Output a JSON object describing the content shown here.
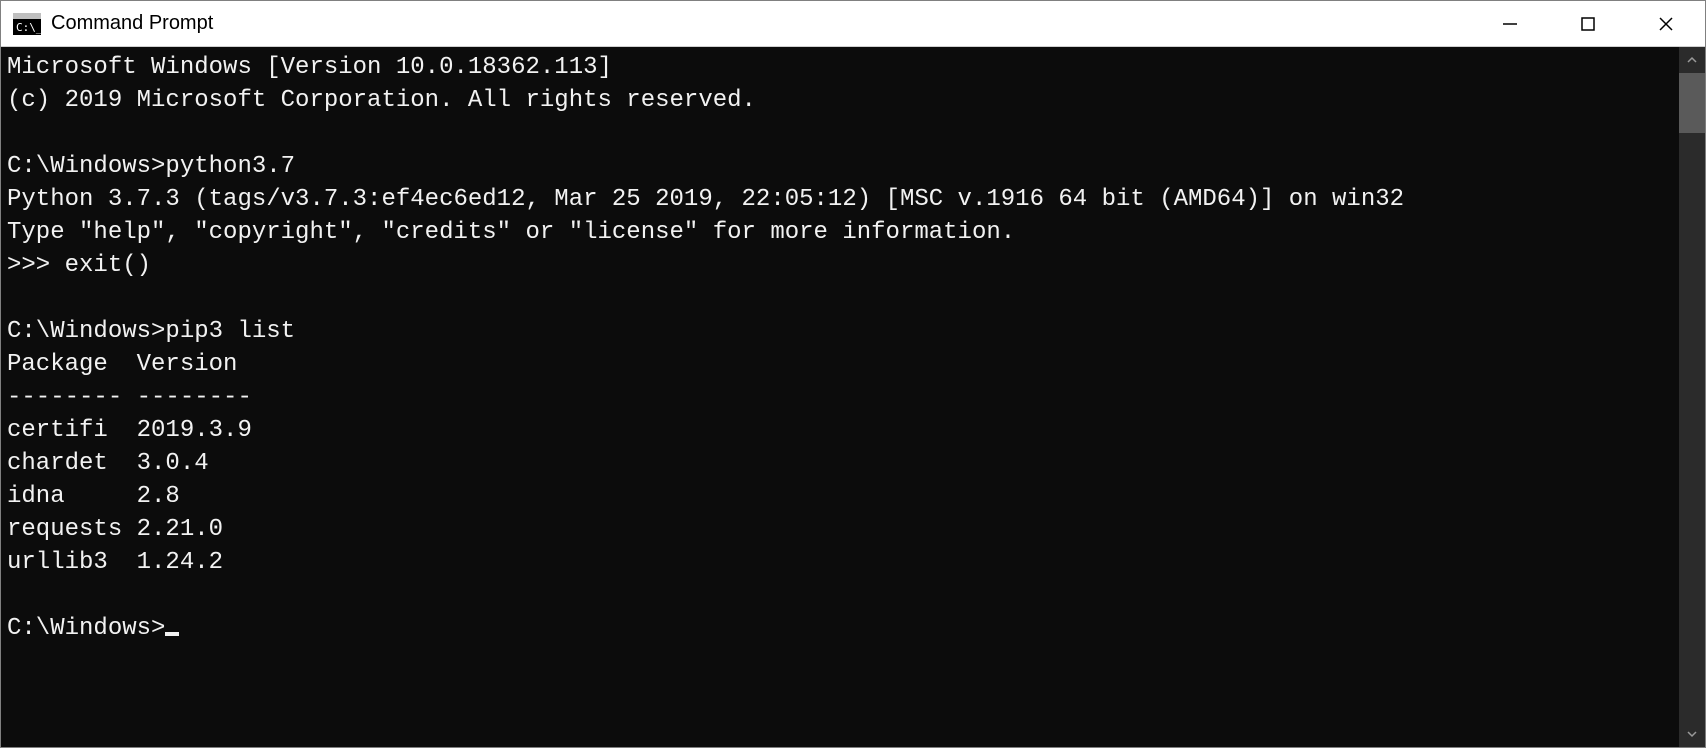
{
  "window": {
    "title": "Command Prompt"
  },
  "terminal": {
    "lines": [
      "Microsoft Windows [Version 10.0.18362.113]",
      "(c) 2019 Microsoft Corporation. All rights reserved.",
      "",
      "C:\\Windows>python3.7",
      "Python 3.7.3 (tags/v3.7.3:ef4ec6ed12, Mar 25 2019, 22:05:12) [MSC v.1916 64 bit (AMD64)] on win32",
      "Type \"help\", \"copyright\", \"credits\" or \"license\" for more information.",
      ">>> exit()",
      "",
      "C:\\Windows>pip3 list",
      "Package  Version",
      "-------- --------",
      "certifi  2019.3.9",
      "chardet  3.0.4",
      "idna     2.8",
      "requests 2.21.0",
      "urllib3  1.24.2",
      "",
      "C:\\Windows>"
    ]
  }
}
